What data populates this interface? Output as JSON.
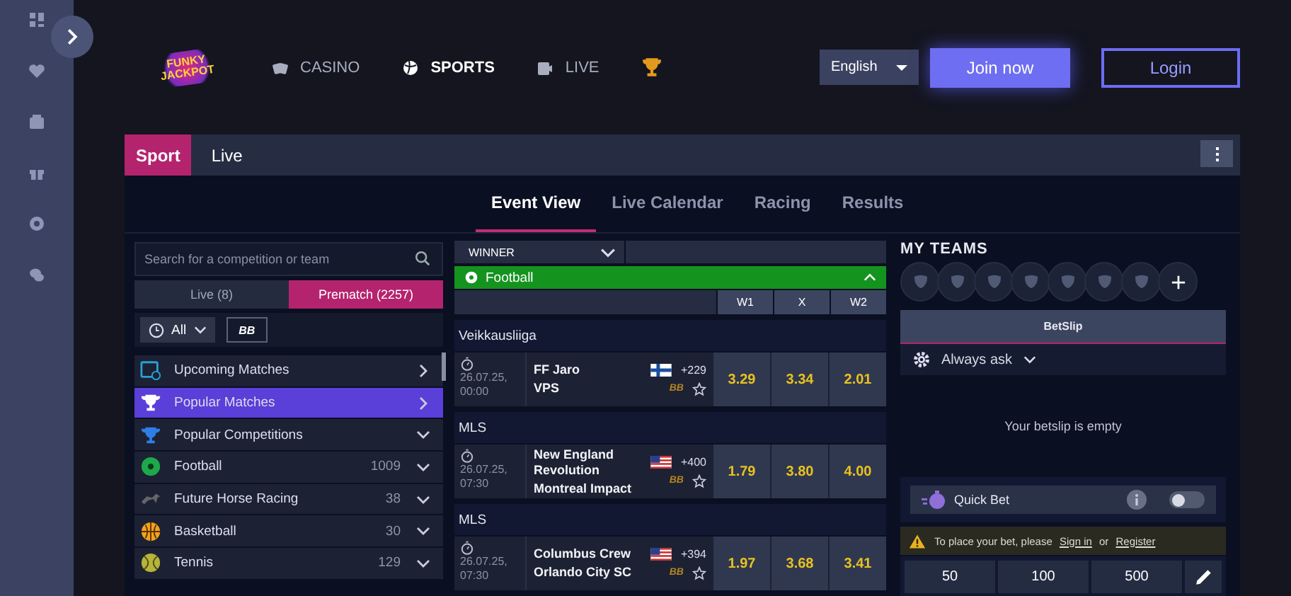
{
  "header": {
    "logo_text": "FUNKY JACKPOT",
    "nav": [
      {
        "label": "CASINO",
        "selected": false
      },
      {
        "label": "SPORTS",
        "selected": true
      },
      {
        "label": "LIVE",
        "selected": false
      }
    ],
    "language": "English",
    "join_button": "Join now",
    "login_button": "Login"
  },
  "panel_tabs": [
    {
      "label": "Sport",
      "selected": true
    },
    {
      "label": "Live",
      "selected": false
    }
  ],
  "views": [
    {
      "label": "Event View",
      "selected": true
    },
    {
      "label": "Live Calendar",
      "selected": false
    },
    {
      "label": "Racing",
      "selected": false
    },
    {
      "label": "Results",
      "selected": false
    }
  ],
  "sidebar": {
    "search": {
      "placeholder": "Search for a competition or team"
    },
    "modes": [
      {
        "label": "Live (8)",
        "selected": false
      },
      {
        "label": "Prematch (2257)",
        "selected": true
      }
    ],
    "filter": "All",
    "bb_button": "BB",
    "items": [
      {
        "label": "Upcoming Matches",
        "kind": "link",
        "selected": false
      },
      {
        "label": "Popular Matches",
        "kind": "link",
        "selected": true
      },
      {
        "label": "Popular Competitions",
        "kind": "group",
        "selected": false
      },
      {
        "label": "Football",
        "count": "1009",
        "kind": "group",
        "selected": false
      },
      {
        "label": "Future Horse Racing",
        "count": "38",
        "kind": "group",
        "selected": false
      },
      {
        "label": "Basketball",
        "count": "30",
        "kind": "group",
        "selected": false
      },
      {
        "label": "Tennis",
        "count": "129",
        "kind": "group",
        "selected": false
      }
    ]
  },
  "events": {
    "market": "WINNER",
    "sport": {
      "label": "Football",
      "expanded": true
    },
    "columns": [
      "W1",
      "X",
      "W2"
    ],
    "leagues": [
      {
        "name": "Veikkausliiga",
        "matches": [
          {
            "date": "26.07.25,",
            "time": "00:00",
            "home": "FF Jaro",
            "away": "VPS",
            "more": "+229",
            "bb": "BB",
            "favorite": false,
            "odds": [
              "3.29",
              "3.34",
              "2.01"
            ]
          }
        ]
      },
      {
        "name": "MLS",
        "matches": [
          {
            "date": "26.07.25,",
            "time": "07:30",
            "home": "New England Revolution",
            "away": "Montreal Impact",
            "more": "+400",
            "bb": "BB",
            "favorite": false,
            "odds": [
              "1.79",
              "3.80",
              "4.00"
            ]
          }
        ]
      },
      {
        "name": "MLS",
        "matches": [
          {
            "date": "26.07.25,",
            "time": "07:30",
            "home": "Columbus Crew",
            "away": "Orlando City SC",
            "more": "+394",
            "bb": "BB",
            "favorite": false,
            "odds": [
              "1.97",
              "3.68",
              "3.41"
            ]
          }
        ]
      }
    ]
  },
  "betslip": {
    "my_teams": "MY TEAMS",
    "tab": "BetSlip",
    "odds_setting": "Always ask",
    "empty": "Your betslip is empty",
    "quick_bet": {
      "label": "Quick Bet",
      "on": false
    },
    "warning": {
      "text": "To place your bet, please",
      "sign_in": "Sign in",
      "or": "or",
      "register": "Register"
    },
    "stakes": [
      "50",
      "100",
      "500"
    ]
  }
}
